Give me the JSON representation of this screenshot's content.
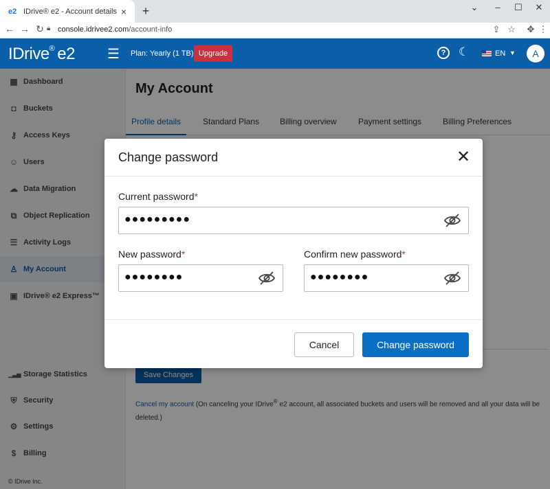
{
  "browser": {
    "tab_title": "IDrive® e2 - Account details",
    "tab_icon": "e2",
    "url_host": "console.idrivee2.com",
    "url_path": "/account-info"
  },
  "header": {
    "logo": "IDrive",
    "logo_mark": "®",
    "logo_suffix": "e2",
    "plan": "Plan: Yearly (1 TB)",
    "upgrade_label": "Upgrade",
    "help": "?",
    "language": "EN",
    "avatar_letter": "A",
    "brand_color": "#0b5ea8",
    "upgrade_color": "#c8313f"
  },
  "sidebar": {
    "items": [
      {
        "label": "Dashboard",
        "icon": "dashboard-icon",
        "glyph": "▦"
      },
      {
        "label": "Buckets",
        "icon": "bucket-icon",
        "glyph": "◘"
      },
      {
        "label": "Access Keys",
        "icon": "key-icon",
        "glyph": "⚷"
      },
      {
        "label": "Users",
        "icon": "users-icon",
        "glyph": "☺"
      },
      {
        "label": "Data Migration",
        "icon": "cloud-icon",
        "glyph": "☁"
      },
      {
        "label": "Object Replication",
        "icon": "replication-icon",
        "glyph": "⧉"
      },
      {
        "label": "Activity Logs",
        "icon": "log-icon",
        "glyph": "☰"
      },
      {
        "label": "My Account",
        "icon": "account-icon",
        "glyph": "♙"
      },
      {
        "label": "IDrive® e2 Express™",
        "icon": "express-icon",
        "glyph": "▣"
      }
    ],
    "bottom_items": [
      {
        "label": "Storage Statistics",
        "icon": "stats-icon",
        "glyph": "▁▃▅"
      },
      {
        "label": "Security",
        "icon": "shield-icon",
        "glyph": "⛨"
      },
      {
        "label": "Settings",
        "icon": "gear-icon",
        "glyph": "⚙"
      },
      {
        "label": "Billing",
        "icon": "billing-icon",
        "glyph": "$"
      }
    ],
    "copyright": "© IDrive Inc."
  },
  "main": {
    "title": "My Account",
    "tabs": [
      {
        "label": "Profile details"
      },
      {
        "label": "Standard Plans"
      },
      {
        "label": "Billing overview"
      },
      {
        "label": "Payment settings"
      },
      {
        "label": "Billing Preferences"
      }
    ],
    "save_label": "Save Changes",
    "cancel_link": "Cancel my account",
    "cancel_text_1": " (On canceling your IDrive",
    "cancel_text_reg": "®",
    "cancel_text_2": " e2 account, all associated buckets and users will be removed and all your data will be deleted.)"
  },
  "modal": {
    "title": "Change password",
    "close": "✕",
    "current_label": "Current password",
    "new_label": "New password",
    "confirm_label": "Confirm new password",
    "required_mark": "*",
    "current_value": "●●●●●●●●●",
    "new_value": "●●●●●●●●",
    "confirm_value": "●●●●●●●●",
    "cancel_label": "Cancel",
    "submit_label": "Change password",
    "submit_color": "#0b6ec5"
  }
}
